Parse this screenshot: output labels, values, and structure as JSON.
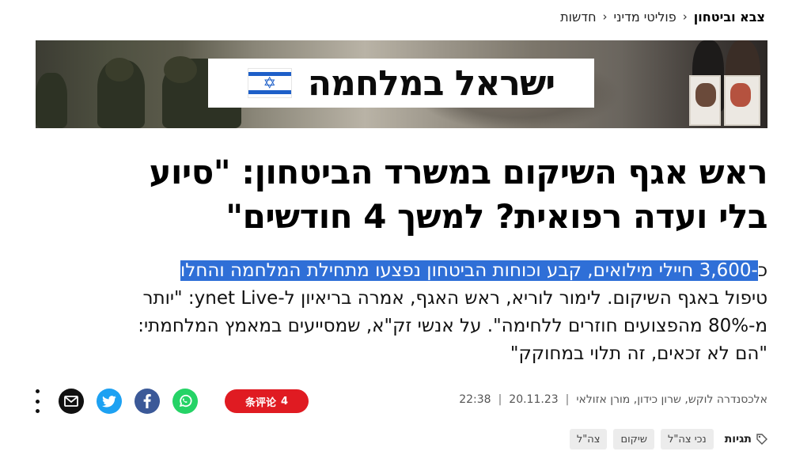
{
  "breadcrumb": {
    "items": [
      "חדשות",
      "פוליטי מדיני",
      "צבא וביטחון"
    ],
    "separator": "‹"
  },
  "banner": {
    "title": "ישראל במלחמה",
    "flag_icon": "israel-flag-icon",
    "colors": {
      "flag_blue": "#1e5fc8"
    }
  },
  "headline": {
    "line1": "ראש אגף השיקום במשרד הביטחון: \"סיוע",
    "line2": "בלי ועדה רפואית? למשך 4 חודשים\""
  },
  "lead": {
    "line1_prefix": "כ",
    "line1_highlight": "-3,600 חיילי מילואים, קבע וכוחות הביטחון נפצעו מתחילת המלחמה והחלו",
    "line2": "טיפול באגף השיקום. לימור לוריא, ראש האגף, אמרה בריאיון ל-ynet Live: \"יותר",
    "line3": "מ-80% מהפצועים חוזרים ללחימה\". על אנשי זק\"א, שמסייעים במאמץ המלחמתי:",
    "line4": "\"הם לא זכאים, זה תלוי במחוקק\""
  },
  "meta": {
    "authors": "אלכסנדרה לוקש, שרון כידון, מורן אזולאי",
    "separator": "|",
    "date": "20.11.23",
    "time": "22:38"
  },
  "share": {
    "comments_count": "4",
    "comments_label": "条评论",
    "icons": [
      "more-options-icon",
      "email-icon",
      "twitter-icon",
      "facebook-icon",
      "whatsapp-icon"
    ],
    "colors": {
      "comments": "#e01b22",
      "twitter": "#1da1f2",
      "facebook": "#3b5998",
      "whatsapp": "#25d366",
      "mail": "#111111"
    }
  },
  "tags": {
    "label": "תגיות",
    "items": [
      "נכי צה\"ל",
      "שיקום",
      "צה\"ל"
    ]
  }
}
